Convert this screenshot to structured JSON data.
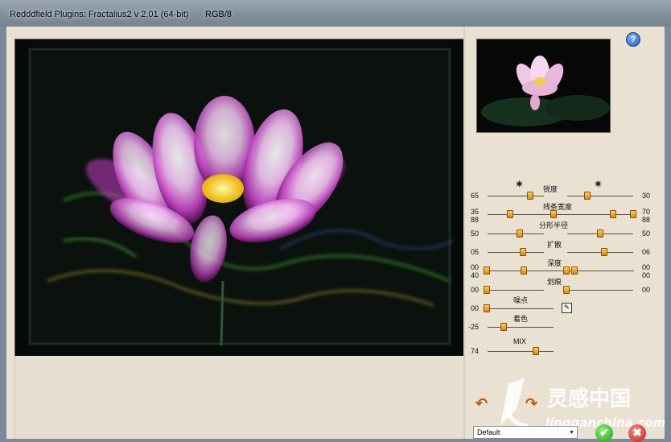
{
  "window": {
    "title": "Redddfield Plugins: Fractalius2 v 2.01 (64-bit)",
    "mode": "RGB/8"
  },
  "help_label": "?",
  "sliders": [
    {
      "name": "锐度",
      "left_value": "65",
      "right_value": "30"
    },
    {
      "name": "线条宽度",
      "left_top": "35",
      "left_bottom": "88",
      "right_top": "70",
      "right_bottom": "88"
    },
    {
      "name": "分形半径",
      "left_value": "50",
      "right_value": "50"
    },
    {
      "name": "扩散",
      "left_value": "05",
      "right_value": "06"
    },
    {
      "name": "深度",
      "left_top": "00",
      "left_bottom": "40",
      "right_top": "00",
      "right_bottom": "00"
    },
    {
      "name": "划痕",
      "left_value": "00",
      "right_value": "00"
    },
    {
      "name": "噪点",
      "left_value": "00"
    },
    {
      "name": "着色",
      "left_value": "-25"
    },
    {
      "name": "MIX",
      "left_value": "74"
    }
  ],
  "preset": {
    "value": "Default"
  },
  "watermark": {
    "brand": "灵感中国",
    "url": "lingganchina.com"
  },
  "icons": {
    "help": "help-icon",
    "sharpness_star": "star-icon",
    "edit": "pencil-icon",
    "undo": "undo-arrow-icon",
    "redo": "redo-arrow-icon",
    "ok": "checkmark-icon",
    "cancel": "close-icon"
  },
  "colors": {
    "panel_bg": "#e9e2d2",
    "knob": "#f0a020",
    "ok": "#2bb820",
    "cancel": "#d42020"
  }
}
